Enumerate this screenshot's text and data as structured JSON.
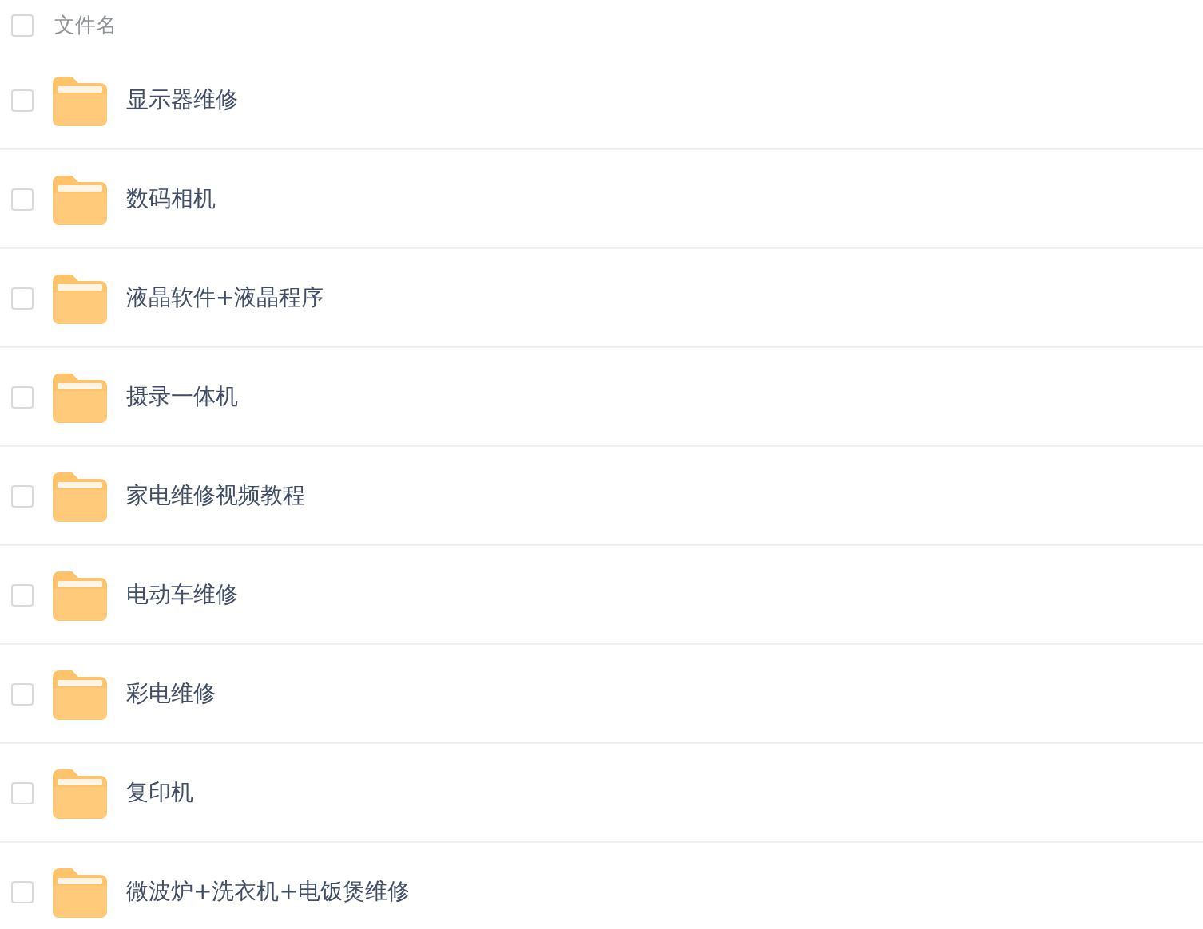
{
  "header": {
    "label": "文件名",
    "checked": false
  },
  "files": [
    {
      "name": "显示器维修",
      "checked": false
    },
    {
      "name": "数码相机",
      "checked": false
    },
    {
      "name": "液晶软件+液晶程序",
      "checked": false
    },
    {
      "name": "摄录一体机",
      "checked": false
    },
    {
      "name": "家电维修视频教程",
      "checked": false
    },
    {
      "name": "电动车维修",
      "checked": false
    },
    {
      "name": "彩电维修",
      "checked": false
    },
    {
      "name": "复印机",
      "checked": false
    },
    {
      "name": "微波炉+洗衣机+电饭煲维修",
      "checked": false
    }
  ]
}
